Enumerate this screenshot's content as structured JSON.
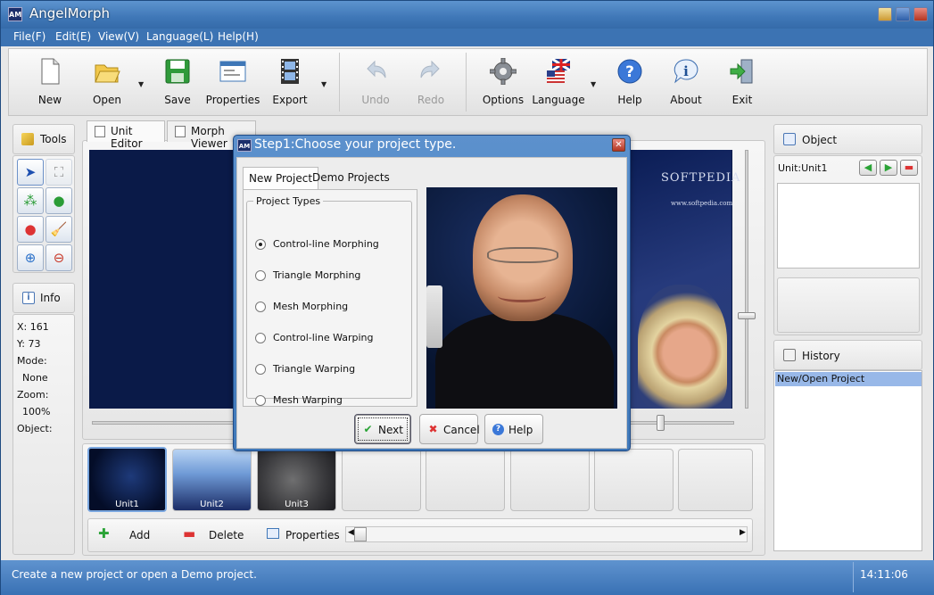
{
  "window": {
    "title": "AngelMorph",
    "icon_text": "AM"
  },
  "menu": [
    "File(F)",
    "Edit(E)",
    "View(V)",
    "Language(L)",
    "Help(H)"
  ],
  "toolbar": {
    "new": "New",
    "open": "Open",
    "save": "Save",
    "properties": "Properties",
    "export": "Export",
    "undo": "Undo",
    "redo": "Redo",
    "options": "Options",
    "language": "Language",
    "help": "Help",
    "about": "About",
    "exit": "Exit"
  },
  "tools_panel": {
    "title": "Tools"
  },
  "info_panel": {
    "title": "Info",
    "x": "X:  161",
    "y": "Y:  73",
    "mode_label": "Mode:",
    "mode_value": "None",
    "zoom_label": "Zoom:",
    "zoom_value": "100%",
    "object_label": "Object:"
  },
  "tabs": {
    "unit_editor": "Unit Editor",
    "morph_viewer": "Morph Viewer"
  },
  "canvas": {
    "watermark": "SOFTPEDIA",
    "watermark_url": "www.softpedia.com"
  },
  "units": [
    "Unit1",
    "Unit2",
    "Unit3"
  ],
  "unit_toolbar": {
    "add": "Add",
    "delete": "Delete",
    "properties": "Properties"
  },
  "object_panel": {
    "title": "Object",
    "unit": "Unit:Unit1"
  },
  "history_panel": {
    "title": "History",
    "items": [
      "New/Open Project"
    ]
  },
  "status": {
    "message": "Create a new project or open a Demo project.",
    "time": "14:11:06"
  },
  "dialog": {
    "title": "Step1:Choose your project type.",
    "tabs": [
      "New Project",
      "Demo Projects"
    ],
    "group_title": "Project Types",
    "options": [
      "Control-line Morphing",
      "Triangle Morphing",
      "Mesh Morphing",
      "Control-line Warping",
      "Triangle Warping",
      "Mesh Warping"
    ],
    "selected_index": 0,
    "buttons": {
      "next": "Next",
      "cancel": "Cancel",
      "help": "Help"
    }
  },
  "colors": {
    "title_bar": "#3f77b7",
    "menu_bar": "#3c73b3",
    "status_bar": "#3870b3",
    "selection": "#98b8e8",
    "canvas_bg": "#0a1a48"
  }
}
